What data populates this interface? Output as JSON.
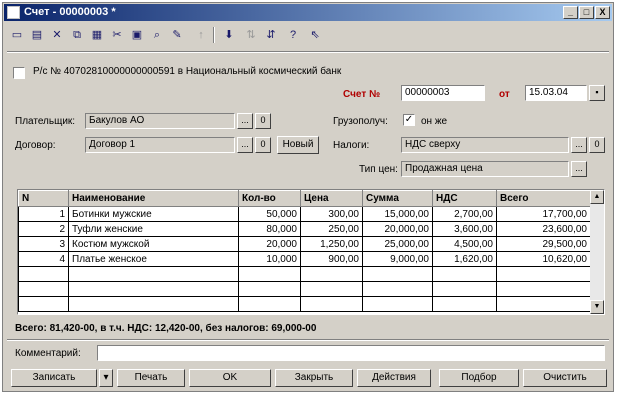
{
  "window": {
    "title": "Счет - 00000003 *",
    "controls": [
      "_",
      "□",
      "X"
    ]
  },
  "toolbar": {
    "icons": [
      "new-doc-icon",
      "open-doc-icon",
      "delete-icon",
      "copy-icon",
      "print-icon",
      "cut-icon",
      "paste-icon",
      "find-icon",
      "up-icon",
      "down-icon",
      "sort-icon",
      "filter-icon",
      "help-icon",
      "pointer-help-icon"
    ]
  },
  "account": {
    "text": "Р/с № 40702810000000000591 в Национальный космический банк"
  },
  "invoice": {
    "label": "Счет №",
    "number": "00000003",
    "date_label": "от",
    "date": "15.03.04"
  },
  "payer": {
    "label": "Плательщик:",
    "value": "Бакулов АО",
    "code": "0"
  },
  "contract": {
    "label": "Договор:",
    "value": "Договор 1",
    "code": "0",
    "new_label": "Новый"
  },
  "consignee": {
    "label": "Грузополуч:",
    "value": "он же"
  },
  "taxes": {
    "label": "Налоги:",
    "value": "НДС сверху",
    "code": "0"
  },
  "price_type": {
    "label": "Тип цен:",
    "value": "Продажная цена"
  },
  "table": {
    "columns": [
      "N",
      "Наименование",
      "Кол-во",
      "Цена",
      "Сумма",
      "НДС",
      "Всего"
    ],
    "rows": [
      [
        "1",
        "Ботинки мужские",
        "50,000",
        "300,00",
        "15,000,00",
        "2,700,00",
        "17,700,00"
      ],
      [
        "2",
        "Туфли женские",
        "80,000",
        "250,00",
        "20,000,00",
        "3,600,00",
        "23,600,00"
      ],
      [
        "3",
        "Костюм мужской",
        "20,000",
        "1,250,00",
        "25,000,00",
        "4,500,00",
        "29,500,00"
      ],
      [
        "4",
        "Платье женское",
        "10,000",
        "900,00",
        "9,000,00",
        "1,620,00",
        "10,620,00"
      ]
    ]
  },
  "summary": "Всего: 81,420-00, в т.ч. НДС: 12,420-00, без налогов: 69,000-00",
  "comment": {
    "label": "Комментарий:",
    "value": ""
  },
  "buttons": {
    "save": "Записать",
    "print": "Печать",
    "ok": "OK",
    "close": "Закрыть",
    "actions": "Действия",
    "select": "Подбор",
    "clear": "Очистить"
  }
}
